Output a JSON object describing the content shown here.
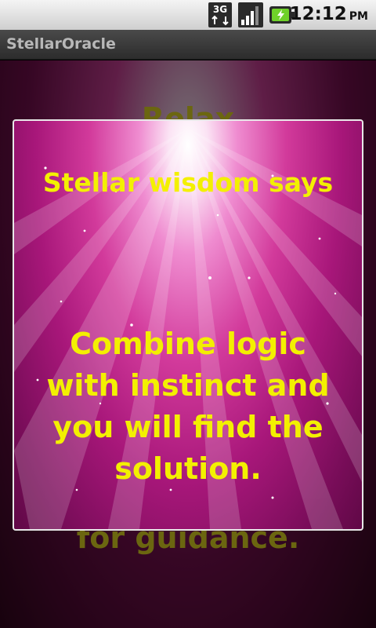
{
  "status_bar": {
    "network_label": "3G",
    "time": "12:12",
    "ampm": "PM",
    "icons": [
      "3g-data-icon",
      "signal-icon",
      "battery-icon"
    ]
  },
  "app": {
    "title": "StellarOracle"
  },
  "background": {
    "line1": "Relax",
    "line2": "for guidance."
  },
  "dialog": {
    "title": "Stellar wisdom says",
    "message": "Combine logic with instinct and you will find the solution."
  },
  "colors": {
    "text_yellow": "#f3f000",
    "magenta": "#d23a9b",
    "dim_text": "#6b6610"
  }
}
